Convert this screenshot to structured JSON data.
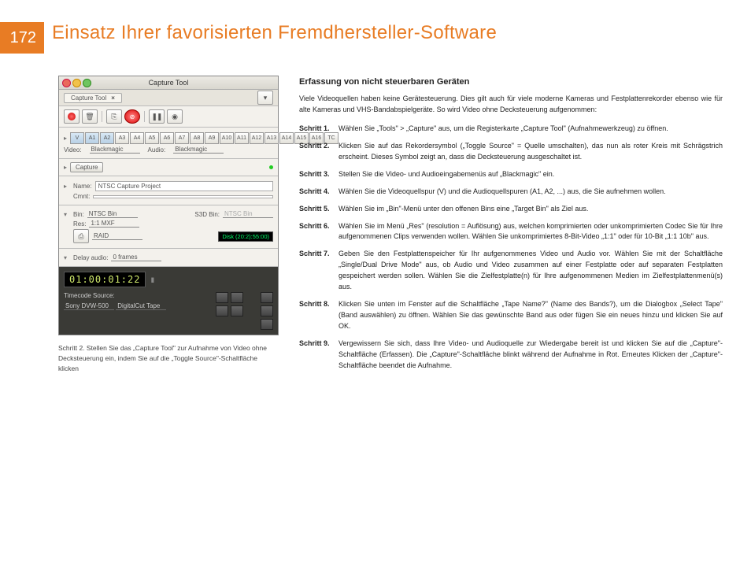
{
  "page": {
    "number": "172",
    "title": "Einsatz Ihrer favorisierten Fremdhersteller-Software"
  },
  "tool": {
    "window_title": "Capture Tool",
    "tab": "Capture Tool",
    "tracks": [
      "V",
      "A1",
      "A2",
      "A3",
      "A4",
      "A5",
      "A6",
      "A7",
      "A8",
      "A9",
      "A10",
      "A11",
      "A12",
      "A13",
      "A14",
      "A15",
      "A16",
      "TC"
    ],
    "video_label": "Video:",
    "video_val": "Blackmagic",
    "audio_label": "Audio:",
    "audio_val": "Blackmagic",
    "capture_btn": "Capture",
    "name_label": "Name:",
    "name_val": "NTSC Capture Project",
    "cmnt_label": "Cmnt:",
    "bin_label": "Bin:",
    "bin_val": "NTSC Bin",
    "s3d_label": "S3D Bin:",
    "s3d_val": "NTSC Bin",
    "res_label": "Res:",
    "res_val": "1:1 MXF",
    "raid": "RAID",
    "disk": "Disk (20:2):55:00)",
    "delay_label": "Delay audio:",
    "delay_val": "0 frames",
    "timecode": "01:00:01:22",
    "tc_src_label": "Timecode Source:",
    "tc_src_val": "Sony DVW-500",
    "dct": "DigitalCut Tape"
  },
  "caption": "Schritt 2. Stellen Sie das „Capture Tool\" zur Aufnahme von Video ohne Decksteuerung ein, indem Sie auf die „Toggle Source\"-Schaltfläche klicken",
  "article": {
    "subtitle": "Erfassung von nicht steuerbaren Geräten",
    "intro": "Viele Videoquellen haben keine Gerätesteuerung. Dies gilt auch für viele moderne Kameras und Festplattenrekorder ebenso wie für alte Kameras und VHS-Bandabspielgeräte. So wird Video ohne Decksteuerung aufgenommen:",
    "steps": [
      {
        "l": "Schritt 1.",
        "t": "Wählen Sie „Tools\" > „Capture\" aus, um die Registerkarte „Capture Tool\" (Aufnahmewerkzeug) zu öffnen."
      },
      {
        "l": "Schritt 2.",
        "t": "Klicken Sie auf das Rekordersymbol („Toggle Source\" = Quelle umschalten), das nun als roter Kreis mit Schrägstrich erscheint. Dieses Symbol zeigt an, dass die Decksteuerung ausgeschaltet ist."
      },
      {
        "l": "Schritt 3.",
        "t": "Stellen Sie die Video- und Audioeingabemenüs auf „Blackmagic\" ein."
      },
      {
        "l": "Schritt 4.",
        "t": "Wählen Sie die Videoquellspur (V) und die Audioquellspuren (A1, A2, ...) aus, die Sie aufnehmen wollen."
      },
      {
        "l": "Schritt 5.",
        "t": "Wählen Sie im „Bin\"-Menü unter den offenen Bins eine „Target Bin\" als Ziel aus."
      },
      {
        "l": "Schritt 6.",
        "t": "Wählen Sie im Menü „Res\" (resolution = Auflösung) aus, welchen komprimierten oder unkomprimierten Codec Sie für Ihre aufgenommenen Clips verwenden wollen. Wählen Sie unkomprimiertes 8-Bit-Video „1:1\" oder für 10-Bit „1:1 10b\" aus."
      },
      {
        "l": "Schritt 7.",
        "t": "Geben Sie den Festplattenspeicher für Ihr aufgenommenes Video und Audio vor. Wählen Sie mit der Schaltfläche „Single/Dual Drive Mode\" aus, ob Audio und Video zusammen auf einer Festplatte oder auf separaten Festplatten gespeichert werden sollen. Wählen Sie die Zielfestplatte(n) für Ihre aufgenommenen Medien im Zielfestplattenmenü(s) aus."
      },
      {
        "l": "Schritt 8.",
        "t": "Klicken Sie unten im Fenster auf die Schaltfläche „Tape Name?\" (Name des Bands?), um die Dialogbox „Select Tape\" (Band auswählen) zu öffnen. Wählen Sie das gewünschte Band aus oder fügen Sie ein neues hinzu und klicken Sie auf OK."
      },
      {
        "l": "Schritt 9.",
        "t": "Vergewissern Sie sich, dass Ihre Video- und Audioquelle zur Wiedergabe bereit ist und klicken Sie auf die „Capture\"-Schaltfläche (Erfassen). Die „Capture\"-Schaltfläche blinkt während der Aufnahme in Rot. Erneutes Klicken der „Capture\"-Schaltfläche beendet die Aufnahme."
      }
    ]
  }
}
